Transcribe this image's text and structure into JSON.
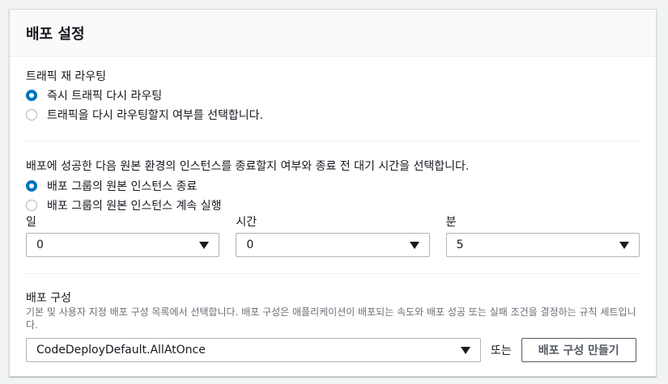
{
  "panel": {
    "title": "배포 설정"
  },
  "traffic": {
    "label": "트래픽 재 라우팅",
    "options": [
      {
        "label": "즉시 트래픽 다시 라우팅",
        "checked": true
      },
      {
        "label": "트래픽을 다시 라우팅할지 여부를 선택합니다.",
        "checked": false
      }
    ]
  },
  "termination": {
    "label": "배포에 성공한 다음 원본 환경의 인스턴스를 종료할지 여부와 종료 전 대기 시간을 선택합니다.",
    "options": [
      {
        "label": "배포 그룹의 원본 인스턴스 종료",
        "checked": true
      },
      {
        "label": "배포 그룹의 원본 인스턴스 계속 실행",
        "checked": false
      }
    ],
    "days": {
      "label": "일",
      "value": "0"
    },
    "hours": {
      "label": "시간",
      "value": "0"
    },
    "minutes": {
      "label": "분",
      "value": "5"
    }
  },
  "config": {
    "label": "배포 구성",
    "description": "기본 및 사용자 지정 배포 구성 목록에서 선택합니다. 배포 구성은 애플리케이션이 배포되는 속도와 배포 성공 또는 실패 조건을 결정하는 규칙 세트입니다.",
    "value": "CodeDeployDefault.AllAtOnce",
    "or_text": "또는",
    "create_button": "배포 구성 만들기"
  },
  "colors": {
    "accent": "#0073bb",
    "border": "#aab7b8",
    "header_bg": "#fafafa",
    "page_bg": "#f2f3f3"
  }
}
